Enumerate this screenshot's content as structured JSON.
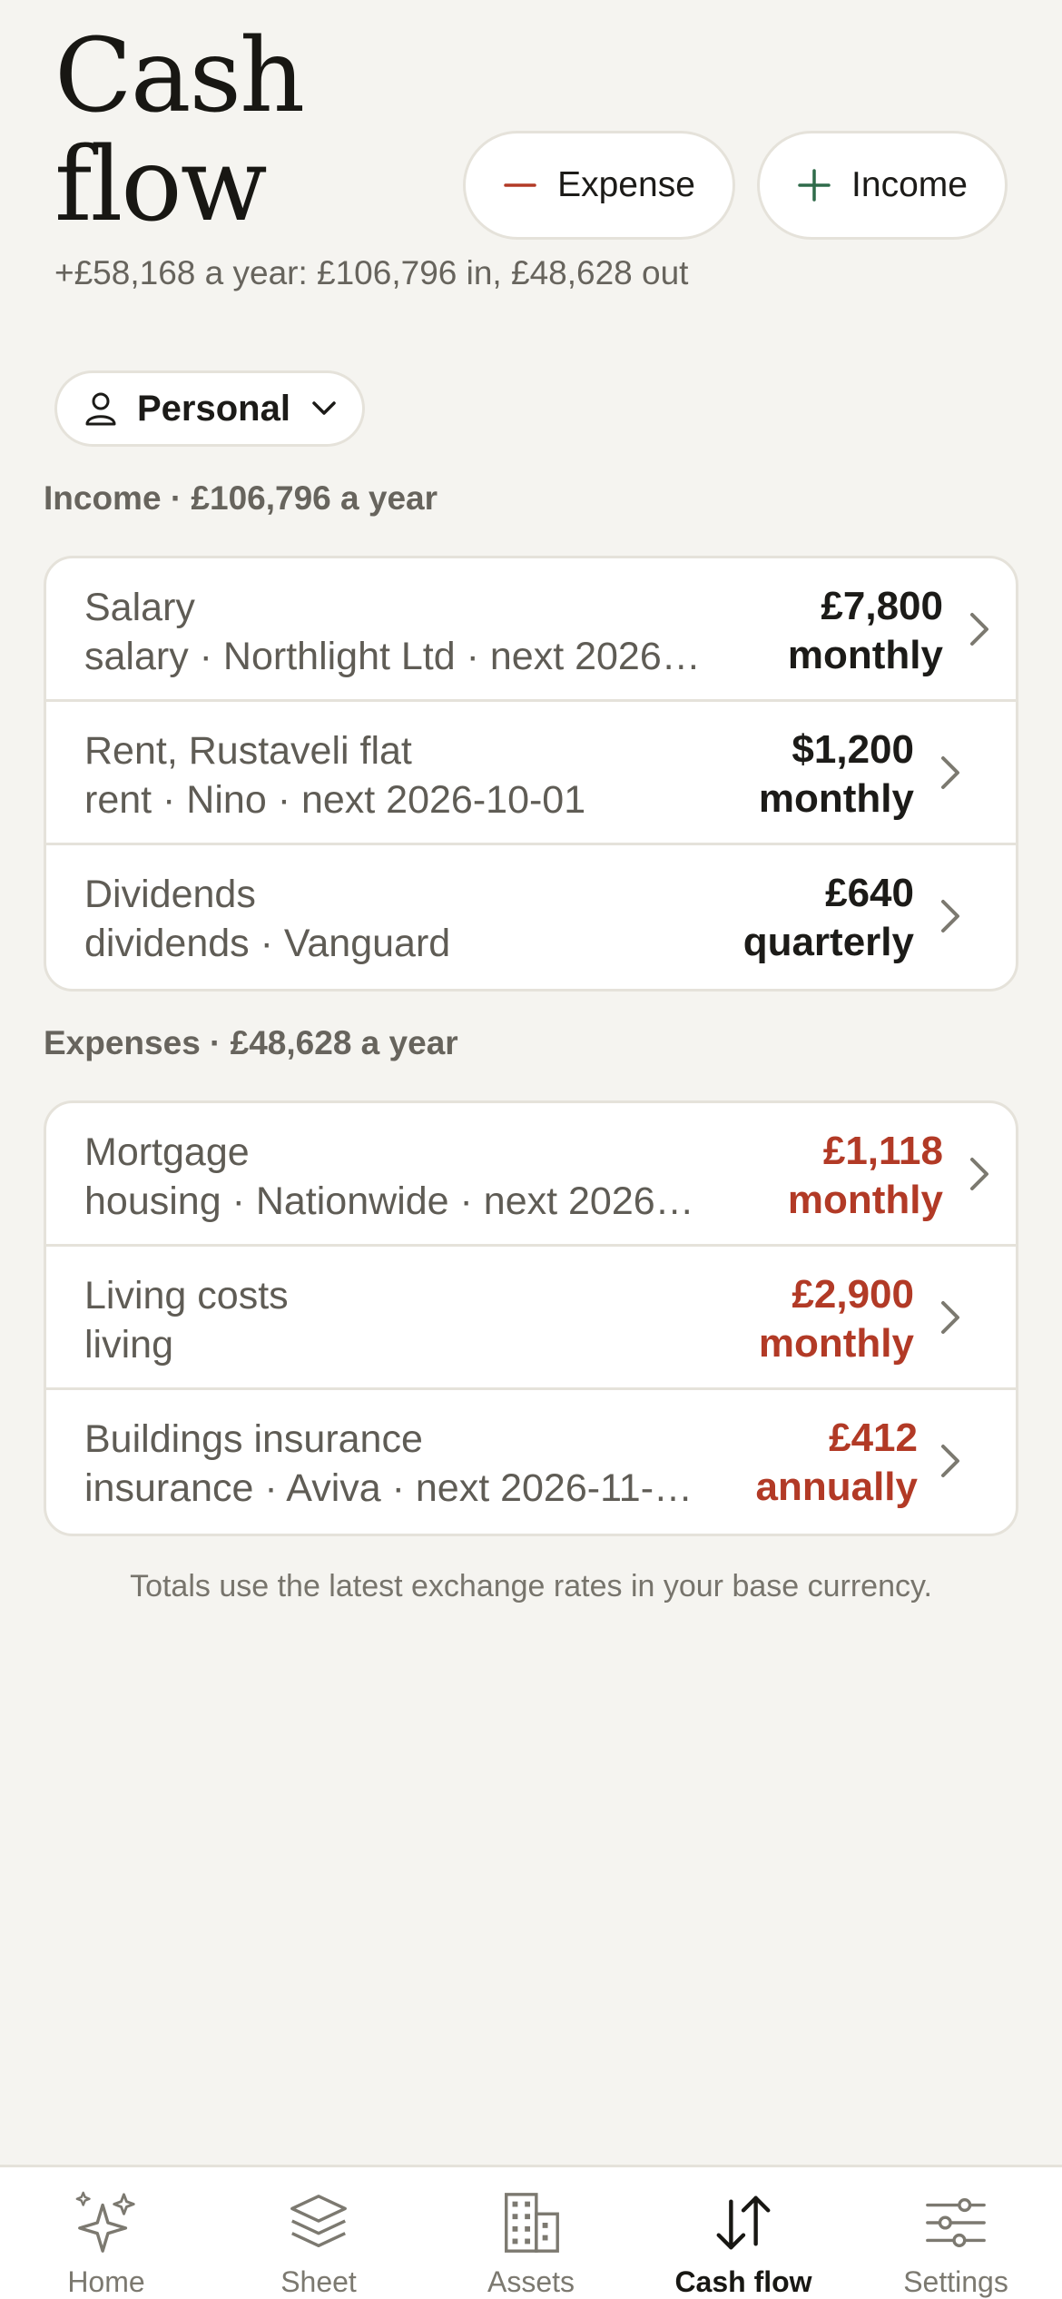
{
  "header": {
    "title": "Cash flow",
    "summary": "+£58,168 a year: £106,796 in, £48,628 out",
    "expense_button": "Expense",
    "income_button": "Income"
  },
  "filter": {
    "label": "Personal"
  },
  "income": {
    "label": "Income · £106,796 a year",
    "rows": [
      {
        "name": "Salary",
        "sub": "salary · Northlight Ltd · next 2026…",
        "amount": "£7,800",
        "freq": "monthly"
      },
      {
        "name": "Rent, Rustaveli flat",
        "sub": "rent · Nino · next 2026-10-01",
        "amount": "$1,200",
        "freq": "monthly"
      },
      {
        "name": "Dividends",
        "sub": "dividends · Vanguard",
        "amount": "£640",
        "freq": "quarterly"
      }
    ]
  },
  "expenses": {
    "label": "Expenses · £48,628 a year",
    "rows": [
      {
        "name": "Mortgage",
        "sub": "housing · Nationwide · next 2026…",
        "amount": "£1,118",
        "freq": "monthly"
      },
      {
        "name": "Living costs",
        "sub": "living",
        "amount": "£2,900",
        "freq": "monthly"
      },
      {
        "name": "Buildings insurance",
        "sub": "insurance · Aviva · next 2026-11-…",
        "amount": "£412",
        "freq": "annually"
      }
    ]
  },
  "footnote": "Totals use the latest exchange rates in your base currency.",
  "tabs": [
    {
      "label": "Home",
      "icon": "sparkle-icon"
    },
    {
      "label": "Sheet",
      "icon": "layers-icon"
    },
    {
      "label": "Assets",
      "icon": "building-icon"
    },
    {
      "label": "Cash flow",
      "icon": "arrows-up-down-icon"
    },
    {
      "label": "Settings",
      "icon": "sliders-icon"
    }
  ],
  "colors": {
    "background": "#f5f4f0",
    "expense_red": "#b23a26",
    "income_green": "#2f6b4a",
    "border": "#e5e2da"
  }
}
